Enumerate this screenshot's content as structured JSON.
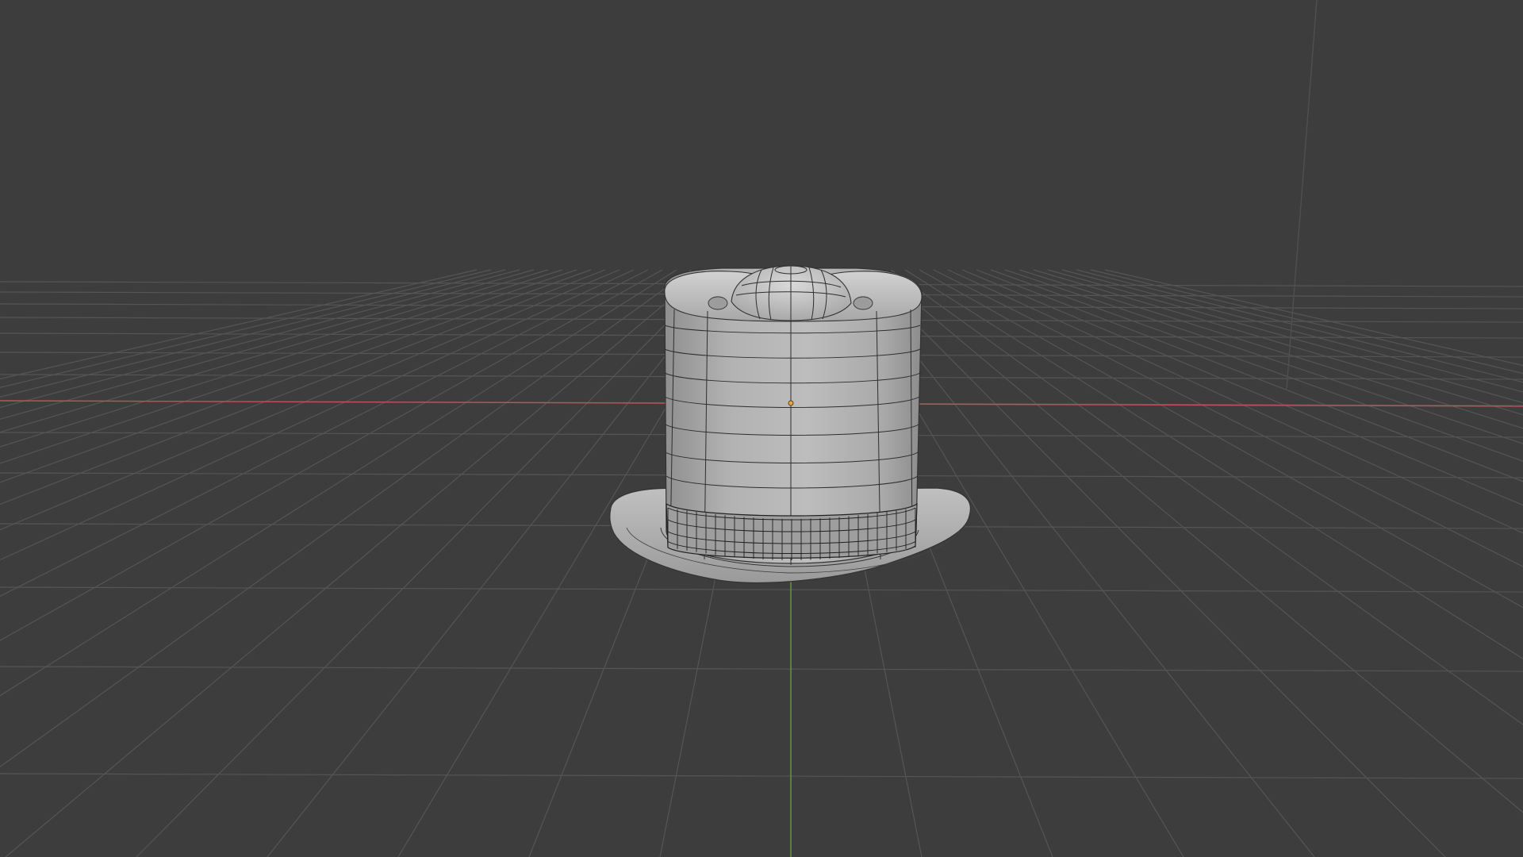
{
  "app": {
    "name": "",
    "view": "3D Viewport"
  },
  "viewport": {
    "background_color": "#3d3d3d",
    "grid_color": "#555555",
    "x_axis_color": "#c0505a",
    "y_axis_color": "#6f9a3a",
    "show_grid": true,
    "show_wireframe_overlay": true
  },
  "scene": {
    "object": {
      "semantic": "top-hat-mesh",
      "shading": "solid",
      "base_color": "#b8b8b8",
      "origin_marker_color": "#f0a23a"
    }
  }
}
